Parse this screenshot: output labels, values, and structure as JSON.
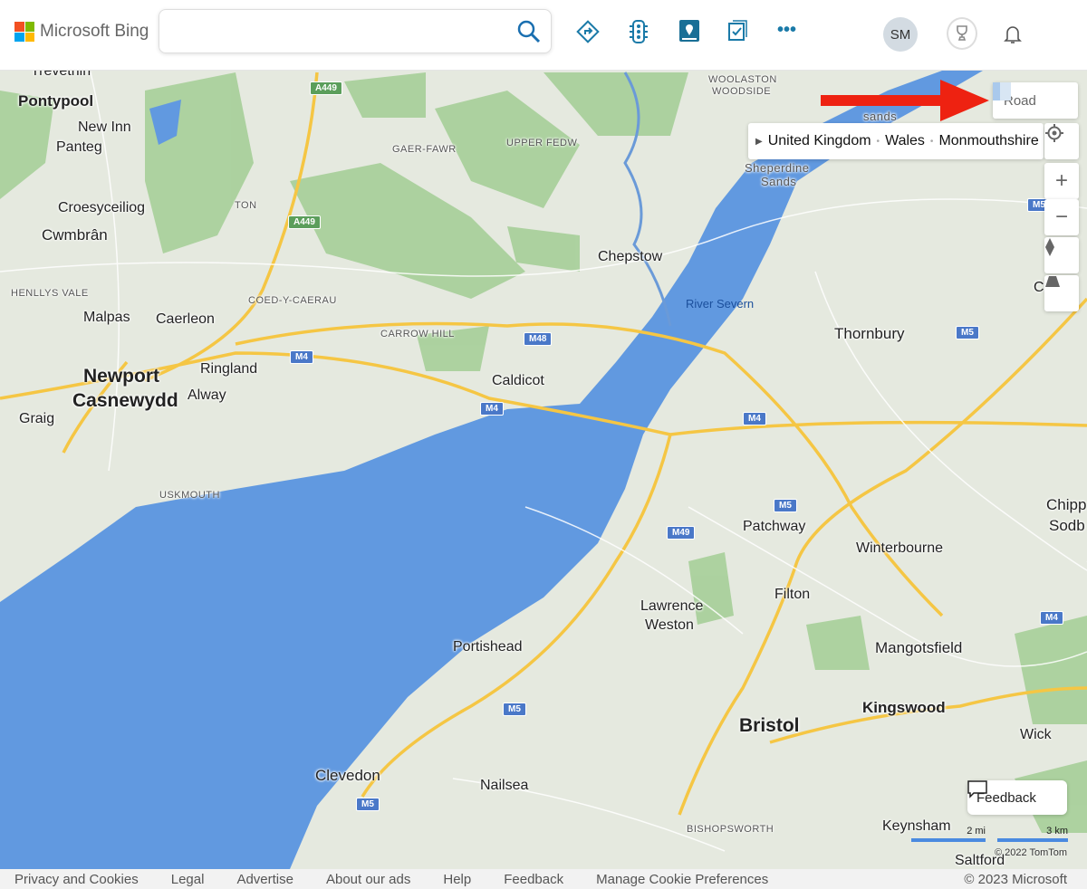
{
  "header": {
    "logo_text": "Microsoft Bing",
    "search": {
      "value": "",
      "placeholder": ""
    },
    "icons": [
      "search-icon",
      "directions-icon",
      "traffic-icon",
      "my-places-icon",
      "collections-icon",
      "more-icon"
    ],
    "avatar_initials": "SM"
  },
  "map": {
    "style_button": "Road",
    "breadcrumb": [
      "United Kingdom",
      "Wales",
      "Monmouthshire"
    ],
    "colors": {
      "water": "#6199e0",
      "land": "#e5e9df",
      "forest": "#9fcb93",
      "motorway": "#f5c644",
      "arrow": "#ee2211"
    },
    "places_big": [
      "Newport",
      "Casnewydd",
      "Bristol"
    ],
    "places_medium": [
      "Pontypool",
      "Cwmbrân",
      "Kingswood",
      "Mangotsfield",
      "Thornbury",
      "Clevedon"
    ],
    "places_small": [
      "New Inn",
      "Panteg",
      "Croesyceiliog",
      "Malpas",
      "Caerleon",
      "Ringland",
      "Alway",
      "Graig",
      "Chepstow",
      "Caldicot",
      "Portishead",
      "Nailsea",
      "Lawrence",
      "Weston",
      "Patchway",
      "Filton",
      "Winterbourne",
      "Keynsham",
      "Saltford",
      "Wick",
      "Chipp",
      "Sodb",
      "Cl",
      "Trevethin"
    ],
    "places_tiny": [
      "WOOLASTON",
      "WOODSIDE",
      "GAER-FAWR",
      "UPPER FEDW",
      "TON",
      "HENLLYS VALE",
      "COED-Y-CAERAU",
      "CARROW HILL",
      "USKMOUTH",
      "BISHOPSWORTH",
      "Sheperdine",
      "Sands",
      "sands"
    ],
    "water_labels": [
      "River Severn"
    ],
    "road_shields": [
      "A449",
      "A449",
      "M4",
      "M48",
      "M4",
      "M4",
      "M5",
      "M49",
      "M5",
      "M5",
      "M5",
      "M4",
      "M5"
    ],
    "feedback": "Feedback",
    "scale": {
      "imperial": "2 mi",
      "metric": "3 km"
    },
    "attribution": "© 2022 TomTom"
  },
  "footer": {
    "links": [
      "Privacy and Cookies",
      "Legal",
      "Advertise",
      "About our ads",
      "Help",
      "Feedback",
      "Manage Cookie Preferences"
    ],
    "copyright": "© 2023 Microsoft"
  }
}
